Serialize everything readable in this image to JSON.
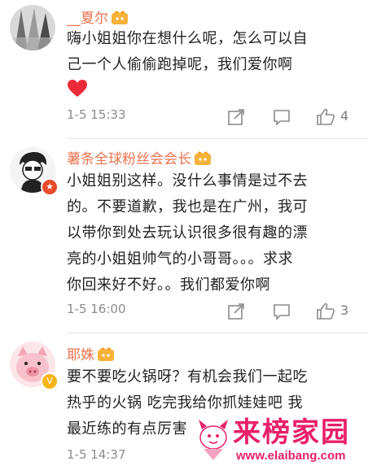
{
  "comments": [
    {
      "username": "__夏尔",
      "text_lines": [
        "嗨小姐姐你在想什么呢，怎么可以自",
        "己一个人偷偷跑掉呢，我们爱你啊"
      ],
      "emoji": "red-heart",
      "time": "1-5 15:33",
      "likes": "4"
    },
    {
      "username": "薯条全球粉丝会会长",
      "text_lines": [
        "小姐姐别这样。没什么事情是过不去",
        "的。不要道歉，我也是在广州，我可",
        "以带你到处去玩认识很多很有趣的漂",
        "亮的小姐姐帅气的小哥哥。。。求求",
        "你回来好不好。。我们都爱你啊"
      ],
      "time": "1-5 16:00",
      "likes": "3"
    },
    {
      "username": "耶姝",
      "text_lines": [
        "要不要吃火锅呀？有机会我们一起吃",
        "热乎的火锅 吃完我给你抓娃娃吧 我",
        "最近练的有点厉害"
      ],
      "time": "1-5 14:37"
    }
  ],
  "watermark": {
    "title": "来榜家园",
    "url": "www.elaibang.com"
  },
  "colors": {
    "username": "#eb7350",
    "meta": "#8c8c8c",
    "watermark": "#e8206b"
  },
  "icons": [
    "share-icon",
    "comment-icon",
    "like-icon",
    "level-badge-icon",
    "verified-badge-icon"
  ]
}
